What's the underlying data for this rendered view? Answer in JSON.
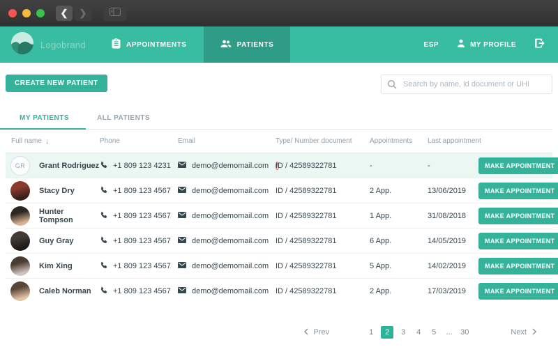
{
  "chrome": {
    "back_symbol": "❮",
    "forward_symbol": "❯"
  },
  "header": {
    "brand": "Logobrand",
    "nav": [
      {
        "label": "APPOINTMENTS",
        "icon": "clipboard-icon",
        "active": false
      },
      {
        "label": "PATIENTS",
        "icon": "people-icon",
        "active": true
      }
    ],
    "language": "ESP",
    "profile_label": "MY PROFILE"
  },
  "toolbar": {
    "create_button": "CREATE NEW PATIENT",
    "search_placeholder": "Search by name, id document or UHI"
  },
  "tabs": [
    {
      "label": "MY PATIENTS",
      "active": true
    },
    {
      "label": "ALL PATIENTS",
      "active": false
    }
  ],
  "table": {
    "columns": [
      "Full name",
      "Phone",
      "Email",
      "Type/ Number document",
      "Appointments",
      "Last appointment"
    ],
    "sort_column": "Full name",
    "sort_arrow": "↓",
    "action_label": "MAKE APPOINTMENT",
    "rows": [
      {
        "name": "Grant Rodriguez",
        "avatar": {
          "initials": "GR"
        },
        "phone": "+1 809 123 4231",
        "email": "demo@demomail.com",
        "email_warning": true,
        "document": "ID / 42589322781",
        "appointments": "-",
        "last_appointment": "-",
        "highlight": true
      },
      {
        "name": "Stacy Dry",
        "avatar": {
          "colors": [
            "#8a3b2e",
            "#35201c"
          ]
        },
        "phone": "+1 809 123 4567",
        "email": "demo@demomail.com",
        "email_warning": false,
        "document": "ID / 42589322781",
        "appointments": "2 App.",
        "last_appointment": "13/06/2019",
        "highlight": false
      },
      {
        "name": "Hunter Tompson",
        "avatar": {
          "colors": [
            "#2e2620",
            "#d9b294"
          ]
        },
        "phone": "+1 809 123 4567",
        "email": "demo@demomail.com",
        "email_warning": false,
        "document": "ID / 42589322781",
        "appointments": "1 App.",
        "last_appointment": "31/08/2018",
        "highlight": false
      },
      {
        "name": "Guy Gray",
        "avatar": {
          "colors": [
            "#413a37",
            "#1d1917"
          ]
        },
        "phone": "+1 809 123 4567",
        "email": "demo@demomail.com",
        "email_warning": false,
        "document": "ID / 42589322781",
        "appointments": "6 App.",
        "last_appointment": "14/05/2019",
        "highlight": false
      },
      {
        "name": "Kim Xing",
        "avatar": {
          "colors": [
            "#4a3b33",
            "#cfc4bd"
          ]
        },
        "phone": "+1 809 123 4567",
        "email": "demo@demomail.com",
        "email_warning": false,
        "document": "ID / 42589322781",
        "appointments": "5 App.",
        "last_appointment": "14/02/2019",
        "highlight": false
      },
      {
        "name": "Caleb Norman",
        "avatar": {
          "colors": [
            "#5a4638",
            "#e3c4a6"
          ]
        },
        "phone": "+1 809 123 4567",
        "email": "demo@demomail.com",
        "email_warning": false,
        "document": "ID / 42589322781",
        "appointments": "2 App.",
        "last_appointment": "17/03/2019",
        "highlight": false
      }
    ]
  },
  "pagination": {
    "prev_label": "Prev",
    "next_label": "Next",
    "pages": [
      "1",
      "2",
      "3",
      "4",
      "5",
      "...",
      "30"
    ],
    "active_page": "2"
  },
  "colors": {
    "header_bg": "#38bda2",
    "header_active_bg": "#2e9c87",
    "accent": "#35b29a",
    "row_highlight": "#eaf7f2",
    "warning": "#f0565f",
    "chrome_bg": "#383838"
  }
}
